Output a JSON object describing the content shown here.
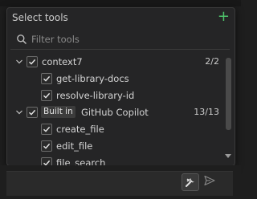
{
  "picker": {
    "title": "Select tools",
    "add_icon": "plus-icon",
    "search_placeholder": "Filter tools",
    "groups": [
      {
        "name": "context7",
        "count": "2/2",
        "checked": true,
        "items": [
          "get-library-docs",
          "resolve-library-id"
        ]
      },
      {
        "badge": "Built in",
        "name": "GitHub Copilot",
        "count": "13/13",
        "checked": true,
        "items": [
          "create_file",
          "edit_file",
          "file_search"
        ]
      }
    ]
  },
  "footer": {
    "tools_icon": "tools-icon",
    "send_icon": "send-icon"
  },
  "colors": {
    "accent_green": "#4ec36b",
    "panel_bg": "#252526",
    "page_bg": "#1e1e1e"
  }
}
